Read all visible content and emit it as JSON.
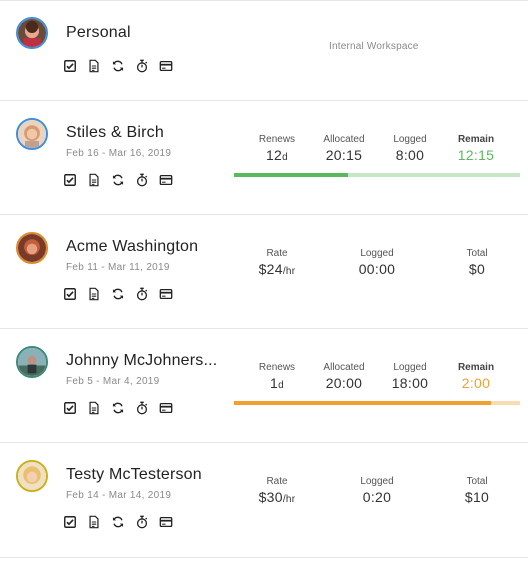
{
  "clients": [
    {
      "name": "Personal",
      "dates": "",
      "workspace_label": "Internal Workspace",
      "avatar_color": "#5a3a2a",
      "avatar_border": "#3f8fdc"
    },
    {
      "name": "Stiles & Birch",
      "dates": "Feb 16 - Mar 16, 2019",
      "avatar_color": "#d9a070",
      "avatar_border": "#3f8fdc",
      "stats": {
        "renews_label": "Renews",
        "renews_value": "12",
        "renews_unit": "d",
        "allocated_label": "Allocated",
        "allocated_value": "20:15",
        "logged_label": "Logged",
        "logged_value": "8:00",
        "remain_label": "Remain",
        "remain_value": "12:15"
      },
      "progress_fraction": 0.4,
      "progress_color": "#5cb85c",
      "progress_track_color": "#c6e6c6",
      "remain_color": "#5cb85c"
    },
    {
      "name": "Acme Washington",
      "dates": "Feb 11 - Mar 11, 2019",
      "avatar_color": "#c0603a",
      "avatar_border": "#e08a2a",
      "stats": {
        "rate_label": "Rate",
        "rate_value": "$24",
        "rate_unit": "/hr",
        "logged_label": "Logged",
        "logged_value": "00:00",
        "total_label": "Total",
        "total_value": "$0"
      }
    },
    {
      "name": "Johnny McJohners...",
      "dates": "Feb 5 - Mar 4, 2019",
      "avatar_color": "#4a6b6a",
      "avatar_border": "#3a8a7a",
      "stats": {
        "renews_label": "Renews",
        "renews_value": "1",
        "renews_unit": "d",
        "allocated_label": "Allocated",
        "allocated_value": "20:00",
        "logged_label": "Logged",
        "logged_value": "18:00",
        "remain_label": "Remain",
        "remain_value": "2:00"
      },
      "progress_fraction": 0.9,
      "progress_color": "#f0a030",
      "progress_track_color": "#f9ddb0",
      "remain_color": "#f0a030"
    },
    {
      "name": "Testy McTesterson",
      "dates": "Feb 14 - Mar 14, 2019",
      "avatar_color": "#e8c070",
      "avatar_border": "#c8b020",
      "stats": {
        "rate_label": "Rate",
        "rate_value": "$30",
        "rate_unit": "/hr",
        "logged_label": "Logged",
        "logged_value": "0:20",
        "total_label": "Total",
        "total_value": "$10"
      }
    }
  ],
  "action_icons": [
    "check-square-icon",
    "document-icon",
    "refresh-icon",
    "stopwatch-icon",
    "credit-card-icon"
  ]
}
